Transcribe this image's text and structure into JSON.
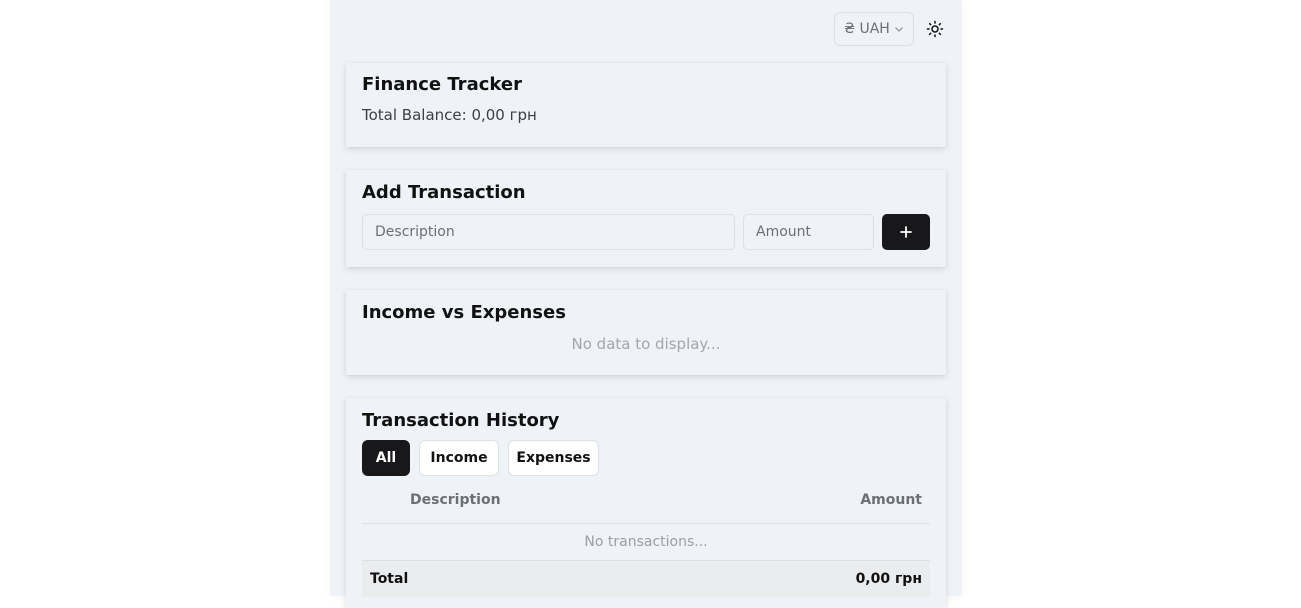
{
  "topbar": {
    "currency_label": "₴ UAH",
    "currency_chevron": "⌄",
    "theme_icon": "sun-icon"
  },
  "summary": {
    "title": "Finance Tracker",
    "balance_text": "Total Balance: 0,00 грн"
  },
  "add_transaction": {
    "title": "Add Transaction",
    "description_placeholder": "Description",
    "amount_placeholder": "Amount",
    "add_label": "+"
  },
  "chart": {
    "title": "Income vs Expenses",
    "empty_text": "No data to display..."
  },
  "history": {
    "title": "Transaction History",
    "filters": [
      "All",
      "Income",
      "Expenses"
    ],
    "active_filter": "All",
    "columns": [
      "Description",
      "Amount"
    ],
    "empty_text": "No transactions...",
    "total_label": "Total",
    "total_value": "0,00 грн"
  },
  "colors": {
    "background": "#eff2f7",
    "accent": "#18181b"
  }
}
